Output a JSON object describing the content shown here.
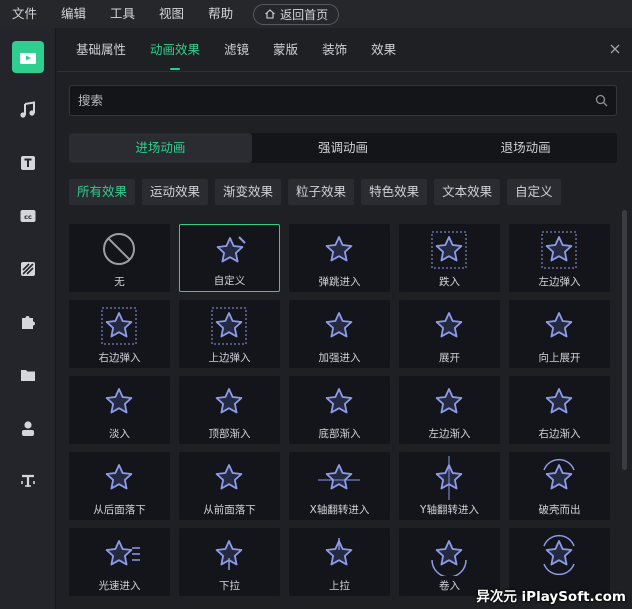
{
  "menubar": {
    "items": [
      "文件",
      "编辑",
      "工具",
      "视图",
      "帮助"
    ],
    "home_button": "返回首页"
  },
  "sidebar": {
    "buttons": [
      "media-icon",
      "music-icon",
      "text-icon",
      "caption-icon",
      "filter-icon",
      "puzzle-icon",
      "folder-icon",
      "person-icon",
      "text-to-speech-icon"
    ],
    "accent": "#2ecf8e"
  },
  "tabs": {
    "items": [
      "基础属性",
      "动画效果",
      "滤镜",
      "蒙版",
      "装饰",
      "效果"
    ],
    "active_index": 1
  },
  "search": {
    "placeholder": "搜索"
  },
  "segments": {
    "items": [
      "进场动画",
      "强调动画",
      "退场动画"
    ],
    "active_index": 0
  },
  "filters": {
    "items": [
      "所有效果",
      "运动效果",
      "渐变效果",
      "粒子效果",
      "特色效果",
      "文本效果",
      "自定义"
    ],
    "active_index": 0
  },
  "grid": {
    "selected_index": 1,
    "items": [
      {
        "label": "无",
        "icon": "none-icon"
      },
      {
        "label": "自定义",
        "icon": "star-edit-icon"
      },
      {
        "label": "弹跳进入",
        "icon": "star-bounce-icon"
      },
      {
        "label": "跌入",
        "icon": "star-drop-icon"
      },
      {
        "label": "左边弹入",
        "icon": "star-left-bounce-icon"
      },
      {
        "label": "右边弹入",
        "icon": "star-right-bounce-icon"
      },
      {
        "label": "上边弹入",
        "icon": "star-top-bounce-icon"
      },
      {
        "label": "加强进入",
        "icon": "star-boost-icon"
      },
      {
        "label": "展开",
        "icon": "star-expand-icon"
      },
      {
        "label": "向上展开",
        "icon": "star-expand-up-icon"
      },
      {
        "label": "淡入",
        "icon": "star-fade-icon"
      },
      {
        "label": "顶部渐入",
        "icon": "star-top-fade-icon"
      },
      {
        "label": "底部渐入",
        "icon": "star-bottom-fade-icon"
      },
      {
        "label": "左边渐入",
        "icon": "star-left-fade-icon"
      },
      {
        "label": "右边渐入",
        "icon": "star-right-fade-icon"
      },
      {
        "label": "从后面落下",
        "icon": "star-fall-back-icon"
      },
      {
        "label": "从前面落下",
        "icon": "star-fall-front-icon"
      },
      {
        "label": "X轴翻转进入",
        "icon": "star-flip-x-icon"
      },
      {
        "label": "Y轴翻转进入",
        "icon": "star-flip-y-icon"
      },
      {
        "label": "破壳而出",
        "icon": "star-break-icon"
      },
      {
        "label": "光速进入",
        "icon": "star-speed-icon"
      },
      {
        "label": "下拉",
        "icon": "star-pull-down-icon"
      },
      {
        "label": "上拉",
        "icon": "star-pull-up-icon"
      },
      {
        "label": "卷入",
        "icon": "star-roll-in-icon"
      },
      {
        "label": "",
        "icon": "star-rotate-icon"
      }
    ]
  },
  "watermark": "异次元 iPlaySoft.com"
}
